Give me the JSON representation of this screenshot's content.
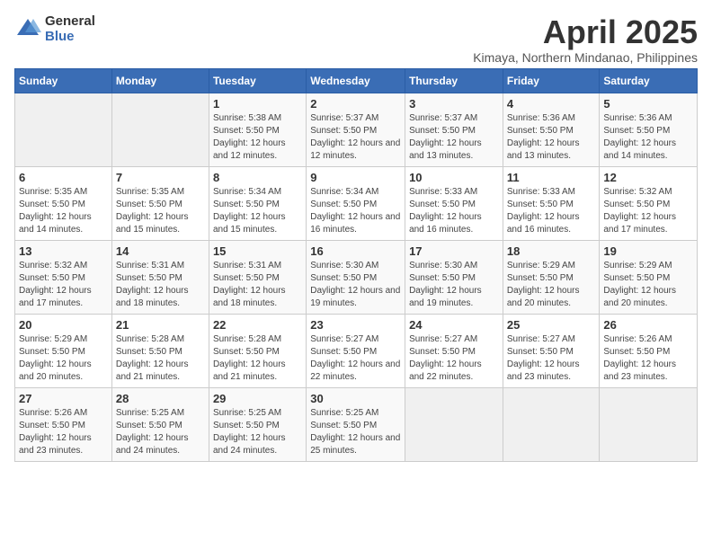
{
  "logo": {
    "general": "General",
    "blue": "Blue"
  },
  "title": "April 2025",
  "subtitle": "Kimaya, Northern Mindanao, Philippines",
  "days_header": [
    "Sunday",
    "Monday",
    "Tuesday",
    "Wednesday",
    "Thursday",
    "Friday",
    "Saturday"
  ],
  "weeks": [
    [
      {
        "day": "",
        "info": ""
      },
      {
        "day": "",
        "info": ""
      },
      {
        "day": "1",
        "info": "Sunrise: 5:38 AM\nSunset: 5:50 PM\nDaylight: 12 hours and 12 minutes."
      },
      {
        "day": "2",
        "info": "Sunrise: 5:37 AM\nSunset: 5:50 PM\nDaylight: 12 hours and 12 minutes."
      },
      {
        "day": "3",
        "info": "Sunrise: 5:37 AM\nSunset: 5:50 PM\nDaylight: 12 hours and 13 minutes."
      },
      {
        "day": "4",
        "info": "Sunrise: 5:36 AM\nSunset: 5:50 PM\nDaylight: 12 hours and 13 minutes."
      },
      {
        "day": "5",
        "info": "Sunrise: 5:36 AM\nSunset: 5:50 PM\nDaylight: 12 hours and 14 minutes."
      }
    ],
    [
      {
        "day": "6",
        "info": "Sunrise: 5:35 AM\nSunset: 5:50 PM\nDaylight: 12 hours and 14 minutes."
      },
      {
        "day": "7",
        "info": "Sunrise: 5:35 AM\nSunset: 5:50 PM\nDaylight: 12 hours and 15 minutes."
      },
      {
        "day": "8",
        "info": "Sunrise: 5:34 AM\nSunset: 5:50 PM\nDaylight: 12 hours and 15 minutes."
      },
      {
        "day": "9",
        "info": "Sunrise: 5:34 AM\nSunset: 5:50 PM\nDaylight: 12 hours and 16 minutes."
      },
      {
        "day": "10",
        "info": "Sunrise: 5:33 AM\nSunset: 5:50 PM\nDaylight: 12 hours and 16 minutes."
      },
      {
        "day": "11",
        "info": "Sunrise: 5:33 AM\nSunset: 5:50 PM\nDaylight: 12 hours and 16 minutes."
      },
      {
        "day": "12",
        "info": "Sunrise: 5:32 AM\nSunset: 5:50 PM\nDaylight: 12 hours and 17 minutes."
      }
    ],
    [
      {
        "day": "13",
        "info": "Sunrise: 5:32 AM\nSunset: 5:50 PM\nDaylight: 12 hours and 17 minutes."
      },
      {
        "day": "14",
        "info": "Sunrise: 5:31 AM\nSunset: 5:50 PM\nDaylight: 12 hours and 18 minutes."
      },
      {
        "day": "15",
        "info": "Sunrise: 5:31 AM\nSunset: 5:50 PM\nDaylight: 12 hours and 18 minutes."
      },
      {
        "day": "16",
        "info": "Sunrise: 5:30 AM\nSunset: 5:50 PM\nDaylight: 12 hours and 19 minutes."
      },
      {
        "day": "17",
        "info": "Sunrise: 5:30 AM\nSunset: 5:50 PM\nDaylight: 12 hours and 19 minutes."
      },
      {
        "day": "18",
        "info": "Sunrise: 5:29 AM\nSunset: 5:50 PM\nDaylight: 12 hours and 20 minutes."
      },
      {
        "day": "19",
        "info": "Sunrise: 5:29 AM\nSunset: 5:50 PM\nDaylight: 12 hours and 20 minutes."
      }
    ],
    [
      {
        "day": "20",
        "info": "Sunrise: 5:29 AM\nSunset: 5:50 PM\nDaylight: 12 hours and 20 minutes."
      },
      {
        "day": "21",
        "info": "Sunrise: 5:28 AM\nSunset: 5:50 PM\nDaylight: 12 hours and 21 minutes."
      },
      {
        "day": "22",
        "info": "Sunrise: 5:28 AM\nSunset: 5:50 PM\nDaylight: 12 hours and 21 minutes."
      },
      {
        "day": "23",
        "info": "Sunrise: 5:27 AM\nSunset: 5:50 PM\nDaylight: 12 hours and 22 minutes."
      },
      {
        "day": "24",
        "info": "Sunrise: 5:27 AM\nSunset: 5:50 PM\nDaylight: 12 hours and 22 minutes."
      },
      {
        "day": "25",
        "info": "Sunrise: 5:27 AM\nSunset: 5:50 PM\nDaylight: 12 hours and 23 minutes."
      },
      {
        "day": "26",
        "info": "Sunrise: 5:26 AM\nSunset: 5:50 PM\nDaylight: 12 hours and 23 minutes."
      }
    ],
    [
      {
        "day": "27",
        "info": "Sunrise: 5:26 AM\nSunset: 5:50 PM\nDaylight: 12 hours and 23 minutes."
      },
      {
        "day": "28",
        "info": "Sunrise: 5:25 AM\nSunset: 5:50 PM\nDaylight: 12 hours and 24 minutes."
      },
      {
        "day": "29",
        "info": "Sunrise: 5:25 AM\nSunset: 5:50 PM\nDaylight: 12 hours and 24 minutes."
      },
      {
        "day": "30",
        "info": "Sunrise: 5:25 AM\nSunset: 5:50 PM\nDaylight: 12 hours and 25 minutes."
      },
      {
        "day": "",
        "info": ""
      },
      {
        "day": "",
        "info": ""
      },
      {
        "day": "",
        "info": ""
      }
    ]
  ]
}
